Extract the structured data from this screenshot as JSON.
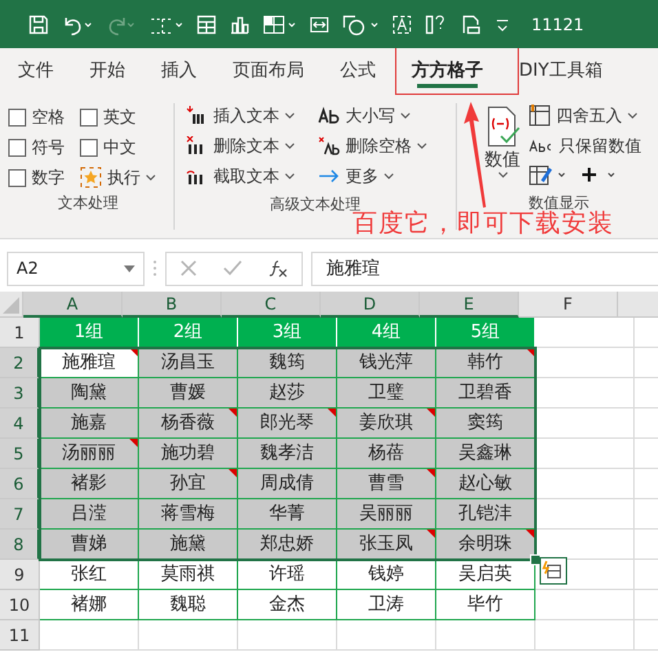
{
  "title_bar": {
    "title": "11121"
  },
  "tabs": [
    {
      "label": "文件",
      "selected": false
    },
    {
      "label": "开始",
      "selected": false
    },
    {
      "label": "插入",
      "selected": false
    },
    {
      "label": "页面布局",
      "selected": false
    },
    {
      "label": "公式",
      "selected": false
    },
    {
      "label": "方方格子",
      "selected": true
    },
    {
      "label": "DIY工具箱",
      "selected": false
    }
  ],
  "text_group": {
    "label": "文本处理",
    "checkboxes": [
      {
        "label": "空格",
        "checked": false
      },
      {
        "label": "英文",
        "checked": false
      },
      {
        "label": "符号",
        "checked": false
      },
      {
        "label": "中文",
        "checked": false
      },
      {
        "label": "数字",
        "checked": false
      }
    ],
    "run_button": "执行"
  },
  "advanced_group": {
    "label": "高级文本处理",
    "buttons": [
      {
        "label": "插入文本",
        "kind": "insert"
      },
      {
        "label": "删除文本",
        "kind": "delete"
      },
      {
        "label": "截取文本",
        "kind": "cut"
      },
      {
        "label": "大小写",
        "kind": "case"
      },
      {
        "label": "删除空格",
        "kind": "space"
      },
      {
        "label": "更多",
        "kind": "more"
      }
    ]
  },
  "number_group": {
    "label": "数值显示",
    "big_button": "数值",
    "buttons": [
      {
        "label": "四舍五入",
        "kind": "round"
      },
      {
        "label": "只保留数值",
        "kind": "keep"
      }
    ]
  },
  "annotation": "百度它，即可下载安装",
  "name_box": "A2",
  "formula": "施雅瑄",
  "columns": [
    {
      "label": "A",
      "selected": true
    },
    {
      "label": "B",
      "selected": true
    },
    {
      "label": "C",
      "selected": true
    },
    {
      "label": "D",
      "selected": true
    },
    {
      "label": "E",
      "selected": true
    },
    {
      "label": "F",
      "selected": false
    }
  ],
  "rows": [
    {
      "number": "1",
      "kind": "header",
      "selected": false,
      "cells": [
        {
          "text": "1组",
          "comment": false,
          "active": false
        },
        {
          "text": "2组",
          "comment": false,
          "active": false
        },
        {
          "text": "3组",
          "comment": false,
          "active": false
        },
        {
          "text": "4组",
          "comment": false,
          "active": false
        },
        {
          "text": "5组",
          "comment": false,
          "active": false
        }
      ]
    },
    {
      "number": "2",
      "kind": "data",
      "selected": true,
      "cells": [
        {
          "text": "施雅瑄",
          "comment": true,
          "active": true
        },
        {
          "text": "汤昌玉",
          "comment": false,
          "active": false
        },
        {
          "text": "魏筠",
          "comment": false,
          "active": false
        },
        {
          "text": "钱光萍",
          "comment": false,
          "active": false
        },
        {
          "text": "韩竹",
          "comment": true,
          "active": false
        }
      ]
    },
    {
      "number": "3",
      "kind": "data",
      "selected": true,
      "cells": [
        {
          "text": "陶黛",
          "comment": false,
          "active": false
        },
        {
          "text": "曹媛",
          "comment": false,
          "active": false
        },
        {
          "text": "赵莎",
          "comment": false,
          "active": false
        },
        {
          "text": "卫璧",
          "comment": false,
          "active": false
        },
        {
          "text": "卫碧香",
          "comment": false,
          "active": false
        }
      ]
    },
    {
      "number": "4",
      "kind": "data",
      "selected": true,
      "cells": [
        {
          "text": "施嘉",
          "comment": false,
          "active": false
        },
        {
          "text": "杨香薇",
          "comment": true,
          "active": false
        },
        {
          "text": "郎光琴",
          "comment": true,
          "active": false
        },
        {
          "text": "姜欣琪",
          "comment": true,
          "active": false
        },
        {
          "text": "窦筠",
          "comment": false,
          "active": false
        }
      ]
    },
    {
      "number": "5",
      "kind": "data",
      "selected": true,
      "cells": [
        {
          "text": "汤丽丽",
          "comment": true,
          "active": false
        },
        {
          "text": "施功碧",
          "comment": false,
          "active": false
        },
        {
          "text": "魏孝洁",
          "comment": false,
          "active": false
        },
        {
          "text": "杨蓓",
          "comment": false,
          "active": false
        },
        {
          "text": "吴鑫琳",
          "comment": false,
          "active": false
        }
      ]
    },
    {
      "number": "6",
      "kind": "data",
      "selected": true,
      "cells": [
        {
          "text": "褚影",
          "comment": false,
          "active": false
        },
        {
          "text": "孙宜",
          "comment": true,
          "active": false
        },
        {
          "text": "周成倩",
          "comment": false,
          "active": false
        },
        {
          "text": "曹雪",
          "comment": true,
          "active": false
        },
        {
          "text": "赵心敏",
          "comment": false,
          "active": false
        }
      ]
    },
    {
      "number": "7",
      "kind": "data",
      "selected": true,
      "cells": [
        {
          "text": "吕滢",
          "comment": false,
          "active": false
        },
        {
          "text": "蒋雪梅",
          "comment": false,
          "active": false
        },
        {
          "text": "华菁",
          "comment": false,
          "active": false
        },
        {
          "text": "吴丽丽",
          "comment": false,
          "active": false
        },
        {
          "text": "孔铠沣",
          "comment": false,
          "active": false
        }
      ]
    },
    {
      "number": "8",
      "kind": "data",
      "selected": true,
      "cells": [
        {
          "text": "曹娣",
          "comment": false,
          "active": false
        },
        {
          "text": "施黛",
          "comment": false,
          "active": false
        },
        {
          "text": "郑忠娇",
          "comment": false,
          "active": false
        },
        {
          "text": "张玉凤",
          "comment": true,
          "active": false
        },
        {
          "text": "余明珠",
          "comment": true,
          "active": false
        }
      ]
    },
    {
      "number": "9",
      "kind": "data",
      "selected": false,
      "cells": [
        {
          "text": "张红",
          "comment": false,
          "active": false
        },
        {
          "text": "莫雨祺",
          "comment": false,
          "active": false
        },
        {
          "text": "许瑶",
          "comment": false,
          "active": false
        },
        {
          "text": "钱婷",
          "comment": false,
          "active": false
        },
        {
          "text": "吴启英",
          "comment": false,
          "active": false
        }
      ]
    },
    {
      "number": "10",
      "kind": "data",
      "selected": false,
      "cells": [
        {
          "text": "褚娜",
          "comment": false,
          "active": false
        },
        {
          "text": "魏聪",
          "comment": false,
          "active": false
        },
        {
          "text": "金杰",
          "comment": false,
          "active": false
        },
        {
          "text": "卫涛",
          "comment": false,
          "active": false
        },
        {
          "text": "毕竹",
          "comment": false,
          "active": false
        }
      ]
    },
    {
      "number": "11",
      "kind": "empty",
      "selected": false
    }
  ]
}
